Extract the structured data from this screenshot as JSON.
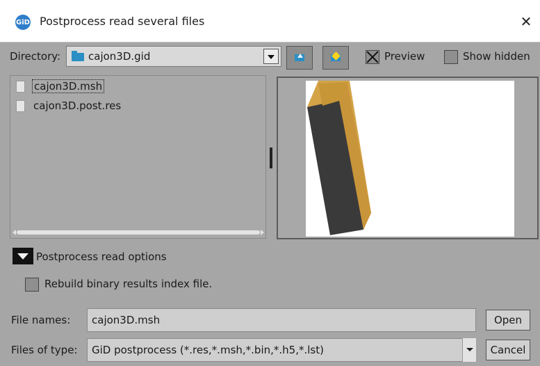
{
  "window": {
    "title": "Postprocess read several files",
    "app_icon_text": "GiD"
  },
  "directory": {
    "label": "Directory:",
    "value": "cajon3D.gid",
    "options": {
      "preview_label": "Preview",
      "preview_checked": true,
      "show_hidden_label": "Show hidden",
      "show_hidden_checked": false
    }
  },
  "files": [
    {
      "name": "cajon3D.msh",
      "selected": true
    },
    {
      "name": "cajon3D.post.res",
      "selected": false
    }
  ],
  "options_section": {
    "toggle_label": "Postprocess read options",
    "rebuild_label": "Rebuild binary results index file.",
    "rebuild_checked": false
  },
  "footer": {
    "file_names_label": "File names:",
    "file_names_value": "cajon3D.msh",
    "file_type_label": "Files of type:",
    "file_type_value": "GiD postprocess (*.res,*.msh,*.bin,*.h5,*.lst)",
    "open_label": "Open",
    "cancel_label": "Cancel"
  },
  "icons": [
    "folder-icon",
    "folder-up-icon",
    "new-folder-icon",
    "file-icon",
    "close-icon",
    "chevron-down-icon"
  ],
  "colors": {
    "accent_blue": "#2b8fc4",
    "preview_box_side": "#3a3a3a",
    "preview_box_edge": "#d4a348"
  }
}
